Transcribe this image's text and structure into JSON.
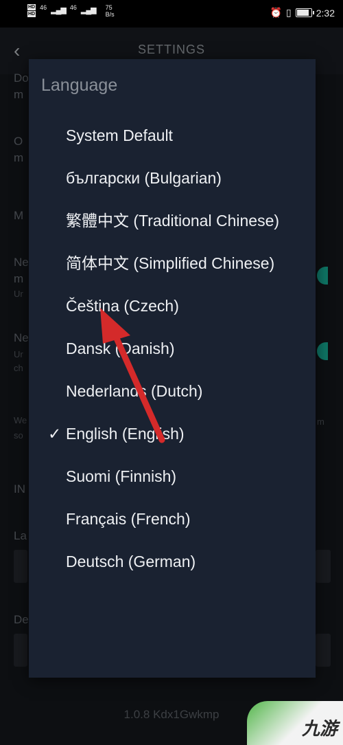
{
  "status_bar": {
    "hd1": "HD",
    "hd2": "HD",
    "net1": "46",
    "net2": "46",
    "speed_value": "75",
    "speed_unit": "B/s",
    "time": "2:32"
  },
  "app": {
    "title": "SETTINGS",
    "version": "1.0.8 Kdx1Gwkmp"
  },
  "background_fragments": {
    "f1": "Do",
    "f2": "m",
    "f3": "O",
    "f4": "m",
    "f5": "M",
    "f6": "Ne",
    "f7": "m",
    "f8": "Ur",
    "f9": "Ne",
    "f10": "Ur",
    "f11": "ch",
    "f12": "We",
    "f13": "so",
    "f14": "m",
    "f15": "IN",
    "f16": "La",
    "f17": "De"
  },
  "dialog": {
    "title": "Language",
    "selected_marker": "✓",
    "languages": [
      {
        "label": "System Default"
      },
      {
        "label": "български (Bulgarian)"
      },
      {
        "label": "繁體中文 (Traditional Chinese)"
      },
      {
        "label": "简体中文 (Simplified Chinese)"
      },
      {
        "label": "Čeština (Czech)"
      },
      {
        "label": "Dansk (Danish)"
      },
      {
        "label": "Nederlands (Dutch)"
      },
      {
        "label": "English (English)"
      },
      {
        "label": "Suomi (Finnish)"
      },
      {
        "label": "Français (French)"
      },
      {
        "label": "Deutsch (German)"
      }
    ]
  },
  "watermark": {
    "text": "九游"
  },
  "colors": {
    "accent": "#16b39a",
    "dialog_bg": "#1a2231",
    "annotation": "#d42a2a"
  }
}
